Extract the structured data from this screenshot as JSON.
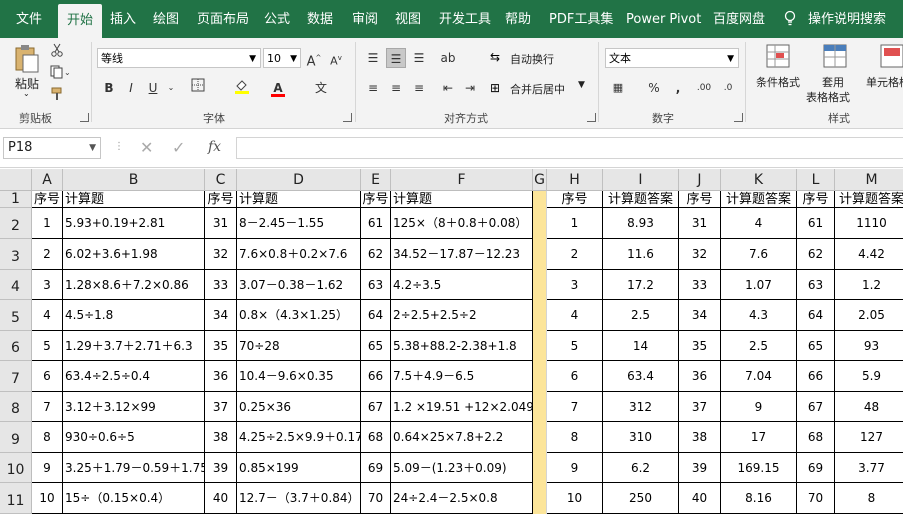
{
  "menu": {
    "items": [
      "文件",
      "开始",
      "插入",
      "绘图",
      "页面布局",
      "公式",
      "数据",
      "审阅",
      "视图",
      "开发工具",
      "帮助",
      "PDF工具集",
      "Power Pivot",
      "百度网盘"
    ],
    "active_index": 1,
    "tell_me": "操作说明搜索"
  },
  "ribbon": {
    "clipboard": {
      "paste": "粘贴",
      "label": "剪贴板"
    },
    "font": {
      "name": "等线",
      "size": "10",
      "label": "字体",
      "bold": "B",
      "italic": "I",
      "underline": "U"
    },
    "alignment": {
      "wrap": "自动换行",
      "merge": "合并后居中",
      "label": "对齐方式"
    },
    "number": {
      "format": "文本",
      "label": "数字"
    },
    "styles": {
      "cond": "条件格式",
      "table_line1": "套用",
      "table_line2": "表格格式",
      "cell": "单元格样",
      "label": "样式"
    }
  },
  "formula_bar": {
    "name_box": "P18",
    "fx": "fx",
    "value": ""
  },
  "columns": [
    {
      "letter": "A",
      "w": 31,
      "align": "center"
    },
    {
      "letter": "B",
      "w": 142,
      "align": "left"
    },
    {
      "letter": "C",
      "w": 66,
      "align": "center",
      "offset": 34
    },
    {
      "letter": "D",
      "w": 124,
      "align": "left"
    },
    {
      "letter": "E",
      "w": 30,
      "align": "center"
    },
    {
      "letter": "F",
      "w": 142,
      "align": "left"
    },
    {
      "letter": "G",
      "w": 14,
      "align": "center"
    },
    {
      "letter": "H",
      "w": 56,
      "align": "center"
    },
    {
      "letter": "I",
      "w": 76,
      "align": "center"
    },
    {
      "letter": "J",
      "w": 42,
      "align": "center"
    },
    {
      "letter": "K",
      "w": 76,
      "align": "center"
    },
    {
      "letter": "L",
      "w": 38,
      "align": "center"
    },
    {
      "letter": "M",
      "w": 74,
      "align": "center"
    }
  ],
  "rows": [
    {
      "num": "1",
      "cells": [
        "序号",
        "计算题",
        "序号",
        "计算题",
        "序号",
        "计算题",
        "",
        "序号",
        "计算题答案",
        "序号",
        "计算题答案",
        "序号",
        "计算题答案"
      ]
    },
    {
      "num": "2",
      "cells": [
        "1",
        "5.93+0.19+2.81",
        "31",
        "8－2.45－1.55",
        "61",
        "125×（8＋0.8＋0.08）",
        "",
        "1",
        "8.93",
        "31",
        "4",
        "61",
        "1110"
      ]
    },
    {
      "num": "3",
      "cells": [
        "2",
        "6.02+3.6+1.98",
        "32",
        "7.6×0.8＋0.2×7.6",
        "62",
        "34.52－17.87－12.23",
        "",
        "2",
        "11.6",
        "32",
        "7.6",
        "62",
        "4.42"
      ]
    },
    {
      "num": "4",
      "cells": [
        "3",
        "1.28×8.6＋7.2×0.86",
        "33",
        "3.07－0.38－1.62",
        "63",
        "4.2÷3.5",
        "",
        "3",
        "17.2",
        "33",
        "1.07",
        "63",
        "1.2"
      ]
    },
    {
      "num": "5",
      "cells": [
        "4",
        "4.5÷1.8",
        "34",
        "0.8×（4.3×1.25）",
        "64",
        "2÷2.5+2.5÷2",
        "",
        "4",
        "2.5",
        "34",
        "4.3",
        "64",
        "2.05"
      ]
    },
    {
      "num": "6",
      "cells": [
        "5",
        "1.29＋3.7＋2.71＋6.3",
        "35",
        "70÷28",
        "65",
        "5.38+88.2-2.38+1.8",
        "",
        "5",
        "14",
        "35",
        "2.5",
        "65",
        "93"
      ]
    },
    {
      "num": "7",
      "cells": [
        "6",
        "63.4÷2.5÷0.4",
        "36",
        "10.4－9.6×0.35",
        "66",
        "7.5＋4.9－6.5",
        "",
        "6",
        "63.4",
        "36",
        "7.04",
        "66",
        "5.9"
      ]
    },
    {
      "num": "8",
      "cells": [
        "7",
        "3.12＋3.12×99",
        "37",
        "0.25×36",
        "67",
        "1.2 ×19.51 +12×2.049",
        "",
        "7",
        "312",
        "37",
        "9",
        "67",
        "48"
      ]
    },
    {
      "num": "9",
      "cells": [
        "8",
        "930÷0.6÷5",
        "38",
        "4.25÷2.5×9.9＋0.17",
        "68",
        "0.64×25×7.8+2.2",
        "",
        "8",
        "310",
        "38",
        "17",
        "68",
        "127"
      ]
    },
    {
      "num": "10",
      "cells": [
        "9",
        "3.25＋1.79－0.59＋1.75",
        "39",
        "0.85×199",
        "69",
        "5.09－(1.23＋0.09)",
        "",
        "9",
        "6.2",
        "39",
        "169.15",
        "69",
        "3.77"
      ]
    },
    {
      "num": "11",
      "cells": [
        "10",
        "15÷（0.15×0.4）",
        "40",
        "12.7－（3.7＋0.84）",
        "70",
        "24÷2.4－2.5×0.8",
        "",
        "10",
        "250",
        "40",
        "8.16",
        "70",
        "8"
      ]
    }
  ]
}
